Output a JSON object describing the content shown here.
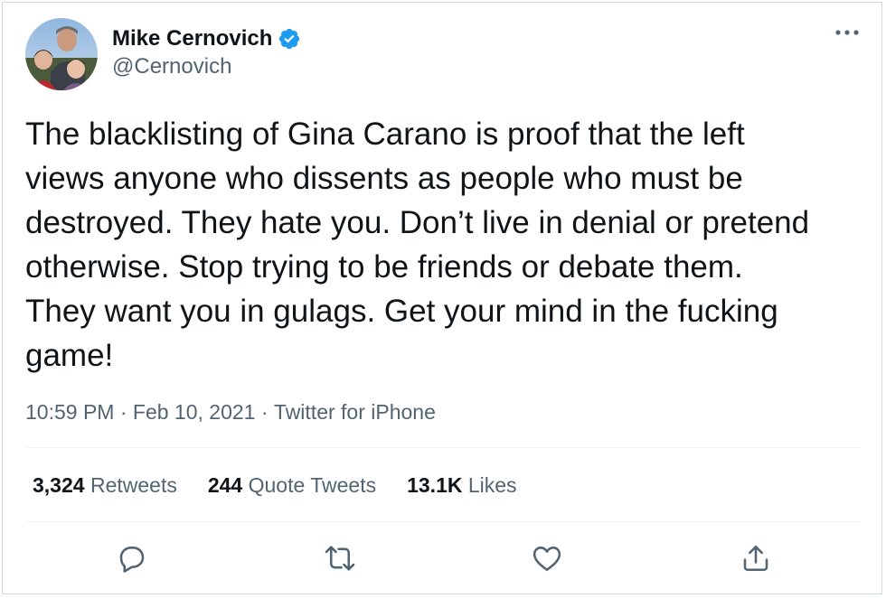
{
  "author": {
    "name": "Mike Cernovich",
    "handle": "@Cernovich",
    "verified": true,
    "avatar_icon": "profile-photo-avatar"
  },
  "tweet": {
    "text": "The blacklisting of Gina Carano is proof that the left\nviews anyone who dissents as people who must be\ndestroyed. They hate you. Don’t live in denial or pretend\notherwise. Stop trying to be friends or debate them.\nThey want you in gulags. Get your mind in the fucking\ngame!",
    "time": "10:59 PM",
    "separator": " · ",
    "date": "Feb 10, 2021",
    "source": "Twitter for iPhone"
  },
  "stats": {
    "retweets_count": "3,324",
    "retweets_label": "Retweets",
    "quotes_count": "244",
    "quotes_label": "Quote Tweets",
    "likes_count": "13.1K",
    "likes_label": "Likes"
  },
  "actions": [
    "reply-icon",
    "retweet-icon",
    "like-icon",
    "share-icon"
  ],
  "colors": {
    "text_primary": "#0f1419",
    "text_secondary": "#536471",
    "verified_blue": "#1d9bf0",
    "border": "#cfd9de",
    "divider": "#eff3f4"
  }
}
